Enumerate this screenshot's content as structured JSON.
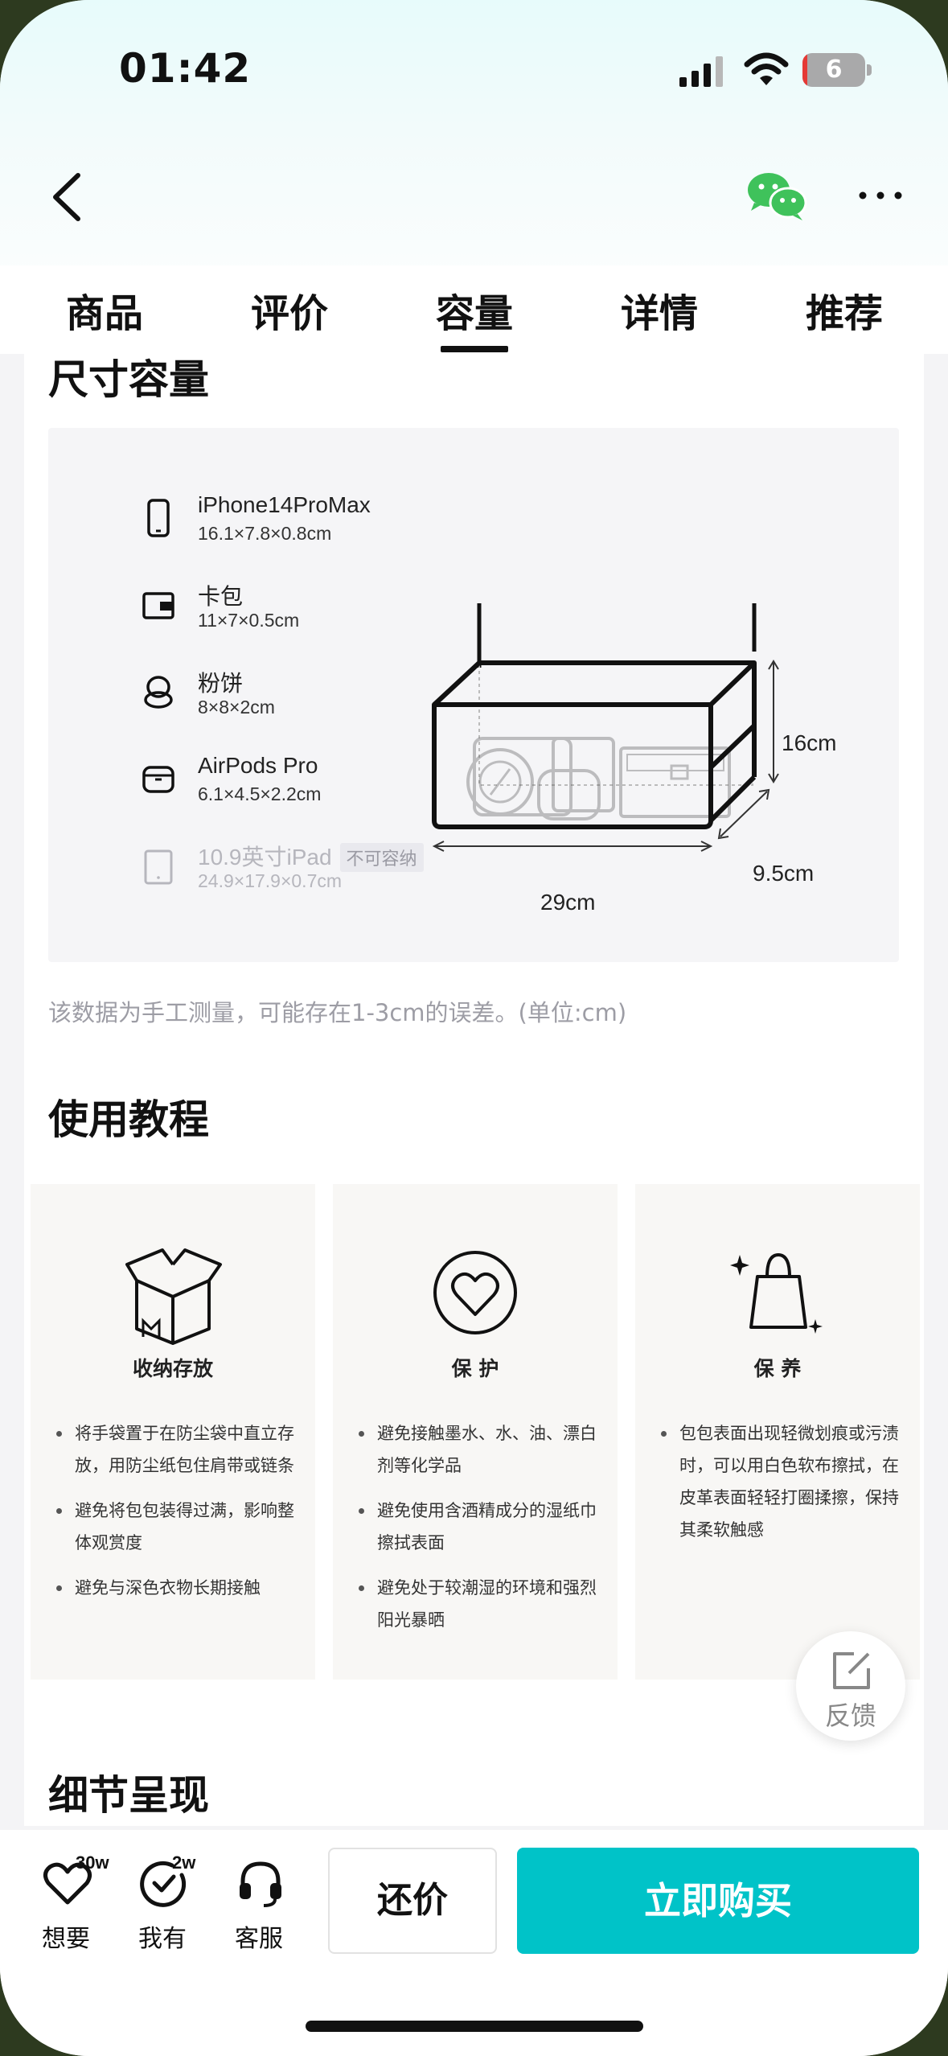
{
  "status_bar": {
    "time": "01:42",
    "battery_level": "6",
    "battery_fraction": 0.06,
    "icons": [
      "signal-icon",
      "wifi-icon",
      "battery-icon"
    ]
  },
  "nav": {
    "icons": [
      "back-arrow-icon",
      "wechat-share-icon",
      "more-dots-icon"
    ]
  },
  "tabs": [
    {
      "label": "商品",
      "active": false
    },
    {
      "label": "评价",
      "active": false
    },
    {
      "label": "容量",
      "active": true
    },
    {
      "label": "详情",
      "active": false
    },
    {
      "label": "推荐",
      "active": false
    }
  ],
  "capacity": {
    "title": "尺寸容量",
    "items": [
      {
        "name": "iPhone14ProMax",
        "size": "16.1×7.8×0.8cm",
        "icon": "phone-icon",
        "fits": true
      },
      {
        "name": "卡包",
        "size": "11×7×0.5cm",
        "icon": "wallet-icon",
        "fits": true
      },
      {
        "name": "粉饼",
        "size": "8×8×2cm",
        "icon": "compact-powder-icon",
        "fits": true
      },
      {
        "name": "AirPods Pro",
        "size": "6.1×4.5×2.2cm",
        "icon": "airpods-case-icon",
        "fits": true
      },
      {
        "name": "10.9英寸iPad",
        "size": "24.9×17.9×0.7cm",
        "icon": "tablet-icon",
        "fits": false,
        "badge": "不可容纳"
      }
    ],
    "dimensions": {
      "height": "16cm",
      "depth": "9.5cm",
      "width": "29cm"
    },
    "note": "该数据为手工测量，可能存在1-3cm的误差。(单位:cm)"
  },
  "tutorial": {
    "title": "使用教程",
    "cards": [
      {
        "title": "收纳存放",
        "icon": "storage-box-icon",
        "points": [
          "将手袋置于在防尘袋中直立存放，用防尘纸包住肩带或链条",
          "避免将包包装得过满，影响整体观赏度",
          "避免与深色衣物长期接触"
        ]
      },
      {
        "title": "保 护",
        "icon": "heart-shield-icon",
        "points": [
          "避免接触墨水、水、油、漂白剂等化学品",
          "避免使用含酒精成分的湿纸巾擦拭表面",
          "避免处于较潮湿的环境和强烈阳光暴晒"
        ]
      },
      {
        "title": "保 养",
        "icon": "sparkle-bag-icon",
        "points": [
          "包包表面出现轻微划痕或污渍时，可以用白色软布擦拭，在皮革表面轻轻打圈揉擦，保持其柔软触感"
        ]
      }
    ]
  },
  "details": {
    "title": "细节呈现"
  },
  "feedback": {
    "label": "反馈",
    "icon": "feedback-edit-icon"
  },
  "bottom_bar": {
    "actions": [
      {
        "label": "想要",
        "count": "30w",
        "icon": "heart-icon"
      },
      {
        "label": "我有",
        "count": "2w",
        "icon": "check-circle-icon"
      },
      {
        "label": "客服",
        "count": "",
        "icon": "headset-icon"
      }
    ],
    "counter_offer": "还价",
    "buy_now": "立即购买"
  },
  "colors": {
    "accent": "#00c3c8",
    "battery_low": "#e53935",
    "wechat_green": "#3fc25b"
  }
}
